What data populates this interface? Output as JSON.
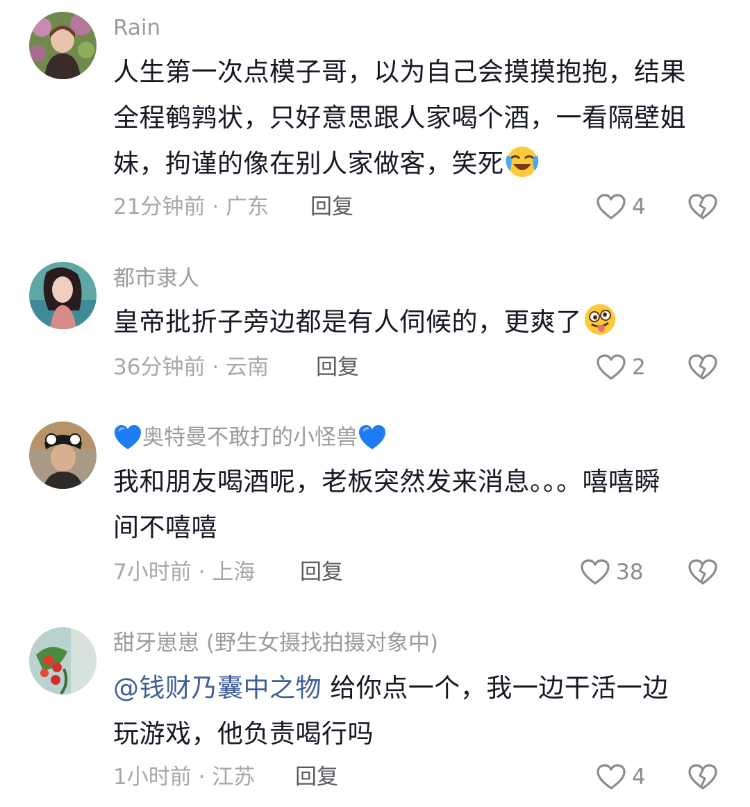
{
  "comments": [
    {
      "username": "Rain",
      "lines": [
        "人生第一次点模子哥，以为自己会摸摸抱抱，结果",
        "全程鹌鹑状，只好意思跟人家喝个酒，一看隔壁姐",
        "妹，拘谨的像在别人家做客，笑死"
      ],
      "emoji": "laughing-crying-emoji",
      "time": "21分钟前",
      "location": "广东",
      "reply": "回复",
      "likes": "4"
    },
    {
      "username": "都市隶人",
      "lines": [
        "皇帝批折子旁边都是有人伺候的，更爽了"
      ],
      "emoji": "silly-tongue-emoji",
      "time": "36分钟前",
      "location": "云南",
      "reply": "回复",
      "likes": "2"
    },
    {
      "username": "奥特曼不敢打的小怪兽",
      "lines": [
        "我和朋友喝酒呢，老板突然发来消息。。。嘻嘻瞬",
        "间不嘻嘻"
      ],
      "time": "7小时前",
      "location": "上海",
      "reply": "回复",
      "likes": "38"
    },
    {
      "username": "甜牙崽崽 (野生女摄找拍摄对象中)",
      "mention": "@钱财乃囊中之物",
      "lines": [
        " 给你点一个，我一边干活一边",
        "玩游戏，他负责喝行吗"
      ],
      "time": "1小时前",
      "location": "江苏",
      "reply": "回复",
      "likes": "4"
    }
  ],
  "separator": "·",
  "colors": {
    "text": "#161823",
    "username": "#9b9b9f",
    "meta": "#a7a7ab",
    "mention": "#3e5f97",
    "blue-heart": "#1e7cf2"
  }
}
